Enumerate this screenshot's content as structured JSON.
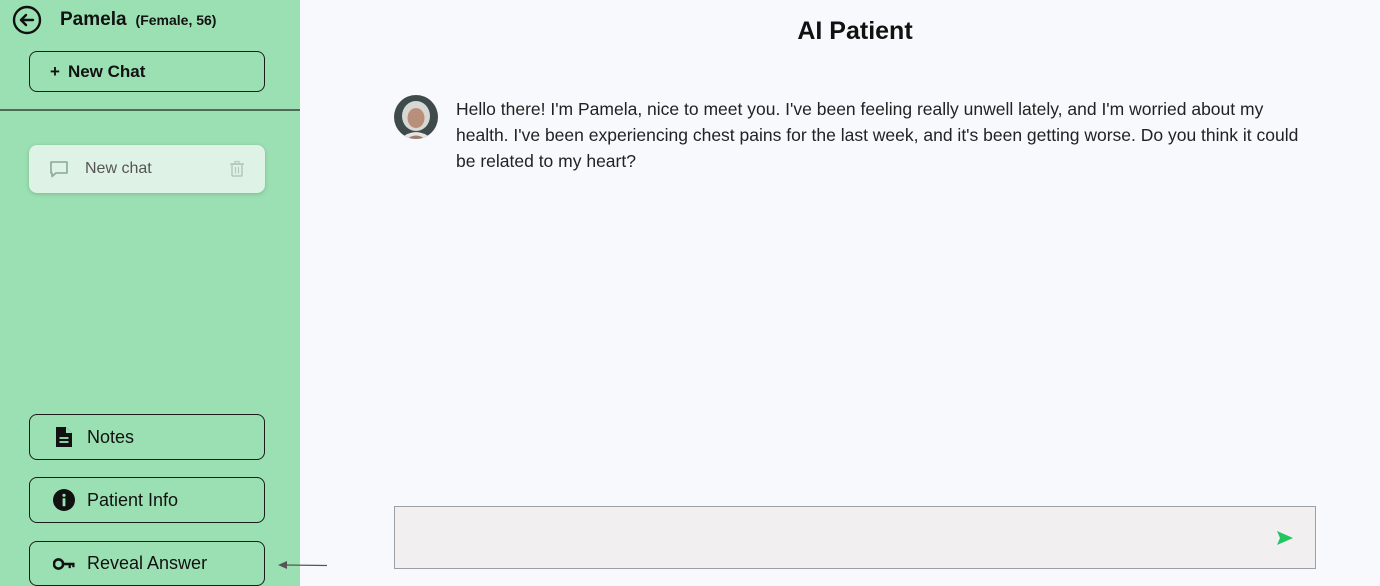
{
  "sidebar": {
    "patient_name": "Pamela",
    "patient_meta": "(Female, 56)",
    "new_chat_label": "New Chat",
    "chats": [
      {
        "label": "New chat"
      }
    ],
    "notes_label": "Notes",
    "patient_info_label": "Patient Info",
    "reveal_answer_label": "Reveal Answer"
  },
  "main": {
    "title": "AI Patient",
    "messages": [
      {
        "sender": "Pamela",
        "text": "Hello there! I'm Pamela, nice to meet you. I've been feeling really unwell lately, and I'm worried about my health. I've been experiencing chest pains for the last week, and it's been getting worse. Do you think it could be related to my heart?"
      }
    ],
    "input": {
      "value": "",
      "placeholder": ""
    }
  },
  "colors": {
    "sidebar_bg": "#9be0b2",
    "main_bg": "#f8f9fc",
    "send_icon": "#22c55e",
    "chat_item_bg": "#def2e6"
  },
  "icons": {
    "back": "arrow-left-circle-icon",
    "chat": "chat-bubble-icon",
    "delete": "trash-icon",
    "notes": "document-icon",
    "info": "info-circle-icon",
    "reveal": "key-icon",
    "send": "send-icon"
  }
}
